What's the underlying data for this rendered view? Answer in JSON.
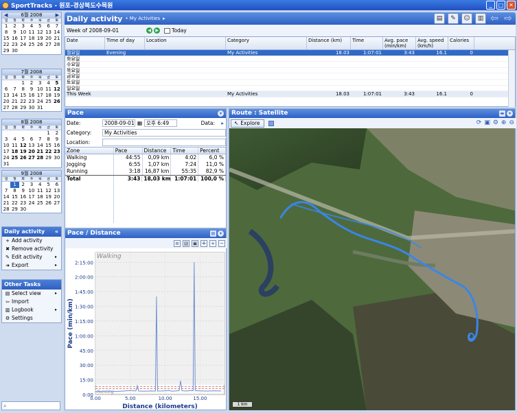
{
  "window": {
    "title": "SportTracks - 원포-경상북도수목원",
    "buttons": [
      "_",
      "□",
      "✕"
    ]
  },
  "calendars": [
    {
      "month": "6월 2008",
      "dow": [
        "일",
        "월",
        "화",
        "수",
        "목",
        "금",
        "토"
      ],
      "weeks": [
        [
          "1",
          "2",
          "3",
          "4",
          "5",
          "6",
          "7"
        ],
        [
          "8",
          "9",
          "10",
          "11",
          "12",
          "13",
          "14"
        ],
        [
          "15",
          "16",
          "17",
          "18",
          "19",
          "20",
          "21"
        ],
        [
          "22",
          "23",
          "24",
          "25",
          "26",
          "27",
          "28"
        ],
        [
          "29",
          "30",
          "",
          "",
          "",
          "",
          ""
        ]
      ],
      "bold": []
    },
    {
      "month": "7월 2008",
      "dow": [
        "일",
        "월",
        "화",
        "수",
        "목",
        "금",
        "토"
      ],
      "weeks": [
        [
          "",
          "",
          "1",
          "2",
          "3",
          "4",
          "5"
        ],
        [
          "6",
          "7",
          "8",
          "9",
          "10",
          "11",
          "12"
        ],
        [
          "13",
          "14",
          "15",
          "16",
          "17",
          "18",
          "19"
        ],
        [
          "20",
          "21",
          "22",
          "23",
          "24",
          "25",
          "26"
        ],
        [
          "27",
          "28",
          "29",
          "30",
          "31",
          "",
          ""
        ]
      ],
      "bold": [
        "5",
        "12",
        "26"
      ]
    },
    {
      "month": "8월 2008",
      "dow": [
        "일",
        "월",
        "화",
        "수",
        "목",
        "금",
        "토"
      ],
      "weeks": [
        [
          "",
          "",
          "",
          "",
          "",
          "1",
          "2"
        ],
        [
          "3",
          "4",
          "5",
          "6",
          "7",
          "8",
          "9"
        ],
        [
          "10",
          "11",
          "12",
          "13",
          "14",
          "15",
          "16"
        ],
        [
          "17",
          "18",
          "19",
          "20",
          "21",
          "22",
          "23"
        ],
        [
          "24",
          "25",
          "26",
          "27",
          "28",
          "29",
          "30"
        ],
        [
          "31",
          "",
          "",
          "",
          "",
          "",
          ""
        ]
      ],
      "bold": [
        "12",
        "18",
        "19",
        "20",
        "21",
        "22",
        "23",
        "25",
        "26",
        "27",
        "28"
      ]
    },
    {
      "month": "9월 2008",
      "dow": [
        "일",
        "월",
        "화",
        "수",
        "목",
        "금",
        "토"
      ],
      "weeks": [
        [
          "",
          "1",
          "2",
          "3",
          "4",
          "5",
          "6"
        ],
        [
          "7",
          "8",
          "9",
          "10",
          "11",
          "12",
          "13"
        ],
        [
          "14",
          "15",
          "16",
          "17",
          "18",
          "19",
          "20"
        ],
        [
          "21",
          "22",
          "23",
          "24",
          "25",
          "26",
          "27"
        ],
        [
          "28",
          "29",
          "30",
          "",
          "",
          "",
          ""
        ]
      ],
      "bold": [],
      "selected": "1"
    }
  ],
  "daily_activity_panel": {
    "title": "Daily activity",
    "items": [
      {
        "icon": "+",
        "label": "Add activity"
      },
      {
        "icon": "✖",
        "label": "Remove activity"
      },
      {
        "icon": "✎",
        "label": "Edit activity",
        "submenu": true
      },
      {
        "icon": "➜",
        "label": "Export",
        "submenu": true
      }
    ]
  },
  "other_tasks_panel": {
    "title": "Other Tasks",
    "items": [
      {
        "icon": "▤",
        "label": "Select view",
        "submenu": true
      },
      {
        "icon": "⇦",
        "label": "Import"
      },
      {
        "icon": "▥",
        "label": "Logbook",
        "submenu": true
      },
      {
        "icon": "⚙",
        "label": "Settings"
      }
    ]
  },
  "main_header": {
    "title": "Daily activity",
    "breadcrumb": "• My Activities",
    "breadcrumb_arrow": "▸"
  },
  "week_bar": {
    "label": "Week of 2008-09-01",
    "today": "Today"
  },
  "activity_table": {
    "columns": [
      "Date",
      "Time of day",
      "Location",
      "Category",
      "Distance (km)",
      "Time",
      "Avg. pace\n(min/km)",
      "Avg. speed\n(km/h)",
      "Calories"
    ],
    "rows": [
      {
        "date": "월요일",
        "time_of_day": "Evening",
        "location": "",
        "category": "My Activities",
        "distance": "18.03",
        "time": "1:07:01",
        "pace": "3:43",
        "speed": "16.1",
        "calories": "0",
        "selected": true
      },
      {
        "date": "화요일"
      },
      {
        "date": "수요일"
      },
      {
        "date": "목요일"
      },
      {
        "date": "금요일"
      },
      {
        "date": "토요일"
      },
      {
        "date": "일요일"
      }
    ],
    "total": {
      "date": "This Week",
      "category": "My Activities",
      "distance": "18.03",
      "time": "1:07:01",
      "pace": "3:43",
      "speed": "16.1",
      "calories": "0"
    }
  },
  "pace_panel": {
    "title": "Pace",
    "date_label": "Date:",
    "date_value": "2008-09-01",
    "time_value": "오후 6:49",
    "data_label": "Data:",
    "category_label": "Category:",
    "category_value": "My Activities",
    "location_label": "Location:",
    "zone_columns": [
      "Zone",
      "Pace",
      "Distance",
      "Time",
      "Percent"
    ],
    "zones": [
      {
        "zone": "Walking",
        "pace": "44:55",
        "distance": "0,09 km",
        "time": "4:02",
        "percent": "6,0 %"
      },
      {
        "zone": "Jogging",
        "pace": "6:55",
        "distance": "1,07 km",
        "time": "7:24",
        "percent": "11,0 %"
      },
      {
        "zone": "Running",
        "pace": "3:18",
        "distance": "16,87 km",
        "time": "55:35",
        "percent": "82,9 %"
      }
    ],
    "total": {
      "zone": "Total",
      "pace": "3:43",
      "distance": "18,03 km",
      "time": "1:07:01",
      "percent": "100,0 %"
    }
  },
  "chart_panel": {
    "title": "Pace / Distance"
  },
  "chart_data": {
    "type": "line",
    "title": "",
    "xlabel": "Distance (kilometers)",
    "ylabel": "Pace (min/km)",
    "x_ticks": [
      "0.00",
      "5.00",
      "10.00",
      "15.00"
    ],
    "y_ticks": [
      "0:00",
      "15:00",
      "30:00",
      "45:00",
      "1:00:00",
      "1:15:00",
      "1:30:00",
      "1:45:00",
      "2:00:00",
      "2:15:00"
    ],
    "xlim": [
      0,
      18.5
    ],
    "ylim_minutes": [
      0,
      145
    ],
    "zone_labels": [
      "Walking",
      "Running"
    ],
    "series": [
      {
        "x": [
          0,
          1,
          2,
          3,
          4,
          5,
          5.8,
          6,
          6.2,
          7,
          8,
          8.6,
          8.75,
          8.9,
          9.5,
          10,
          10.6,
          11,
          11.5,
          12,
          12.2,
          12.4,
          13,
          13.8,
          14,
          14.15,
          14.3,
          15,
          16,
          17,
          18
        ],
        "y_minutes": [
          3,
          3.2,
          3.4,
          3.1,
          3.5,
          4,
          3.6,
          9,
          3.5,
          3.3,
          3.6,
          3.4,
          100,
          3.5,
          3.6,
          3.8,
          4,
          3.3,
          3.6,
          4,
          14,
          3.8,
          3.6,
          4,
          3.8,
          135,
          3.9,
          3.7,
          3.5,
          3.8,
          3.6
        ]
      }
    ],
    "reference_lines_minutes": [
      6,
      8
    ]
  },
  "route_panel": {
    "title": "Route : Satellite",
    "explore_label": "Explore",
    "scale_label": "1 km"
  },
  "colors": {
    "accent": "#2e60c4",
    "selection": "#316ac5",
    "route": "#3a86e8",
    "chart_line": "#6f8fd0"
  }
}
